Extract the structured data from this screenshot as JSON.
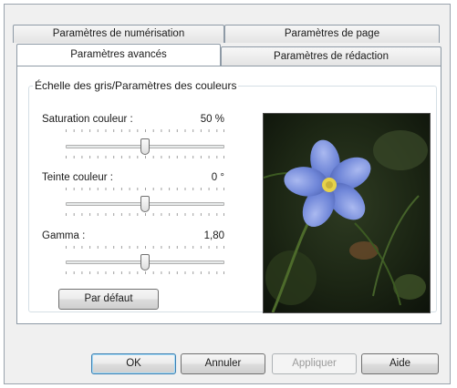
{
  "tabs": {
    "row_back": [
      {
        "label": "Paramètres de numérisation"
      },
      {
        "label": "Paramètres de page"
      }
    ],
    "row_front": [
      {
        "label": "Paramètres avancés",
        "active": true
      },
      {
        "label": "Paramètres de rédaction",
        "active": false
      }
    ]
  },
  "group": {
    "title": "Échelle des gris/Paramètres des couleurs",
    "sliders": [
      {
        "label": "Saturation couleur :",
        "value_text": "50 %",
        "position": 0.5
      },
      {
        "label": "Teinte couleur :",
        "value_text": "0 °",
        "position": 0.5
      },
      {
        "label": "Gamma :",
        "value_text": "1,80",
        "position": 0.5
      }
    ],
    "default_button": "Par défaut"
  },
  "buttons": {
    "ok": "OK",
    "cancel": "Annuler",
    "apply": "Appliquer",
    "help": "Aide"
  },
  "colors": {
    "flower_petal": "#6f86d8",
    "flower_center": "#e6d24a",
    "background_foliage": "#1f2a16"
  }
}
